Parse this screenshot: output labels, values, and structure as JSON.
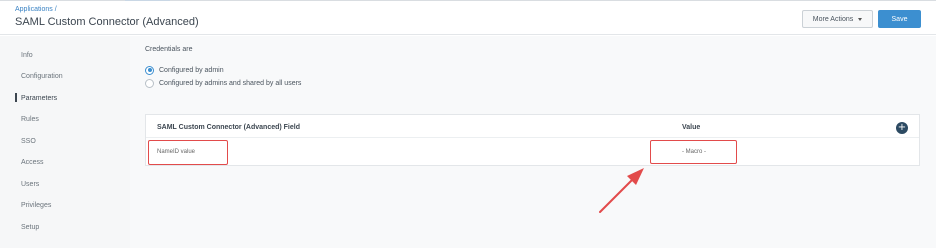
{
  "header": {
    "breadcrumb": "Applications /",
    "title": "SAML Custom Connector (Advanced)",
    "more_actions_label": "More Actions",
    "save_label": "Save"
  },
  "sidebar": {
    "items": [
      {
        "label": "Info"
      },
      {
        "label": "Configuration"
      },
      {
        "label": "Parameters",
        "active": true
      },
      {
        "label": "Rules"
      },
      {
        "label": "SSO"
      },
      {
        "label": "Access"
      },
      {
        "label": "Users"
      },
      {
        "label": "Privileges"
      },
      {
        "label": "Setup"
      }
    ]
  },
  "credentials": {
    "label": "Credentials are",
    "options": [
      {
        "label": "Configured by admin",
        "selected": true
      },
      {
        "label": "Configured by admins and shared by all users",
        "selected": false
      }
    ]
  },
  "table": {
    "columns": [
      "SAML Custom Connector (Advanced) Field",
      "Value"
    ],
    "rows": [
      {
        "field": "NameID value",
        "value": "- Macro -"
      }
    ]
  },
  "colors": {
    "accent": "#3c8fd0",
    "annotation": "#e24b4b",
    "add_button": "#2c4a62"
  }
}
